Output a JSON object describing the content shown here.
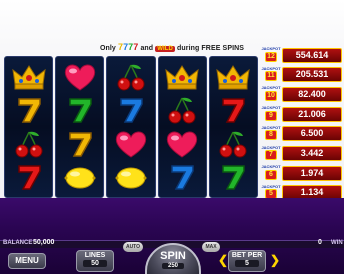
{
  "banner": {
    "only": "Only",
    "sevens": [
      "7",
      "7",
      "7",
      "7"
    ],
    "and": "and",
    "wild": "WILD",
    "during": "during FREE SPINS"
  },
  "reels": [
    [
      "crown",
      "seven-gold",
      "cherry",
      "seven-red"
    ],
    [
      "heart",
      "seven-green",
      "seven-gold",
      "lemon"
    ],
    [
      "cherry",
      "seven-blue",
      "heart",
      "lemon"
    ],
    [
      "crown",
      "cherry",
      "heart",
      "seven-blue"
    ],
    [
      "crown",
      "seven-red",
      "cherry",
      "seven-green"
    ]
  ],
  "jackpots": [
    {
      "label": "JACKPOT",
      "level": "12",
      "value": "554.614"
    },
    {
      "label": "JACKPOT",
      "level": "11",
      "value": "205.531"
    },
    {
      "label": "JACKPOT",
      "level": "10",
      "value": "82.400"
    },
    {
      "label": "JACKPOT",
      "level": "9",
      "value": "21.006"
    },
    {
      "label": "JACKPOT",
      "level": "8",
      "value": "6.500"
    },
    {
      "label": "JACKPOT",
      "level": "7",
      "value": "3.442"
    },
    {
      "label": "JACKPOT",
      "level": "6",
      "value": "1.974"
    },
    {
      "label": "JACKPOT",
      "level": "5",
      "value": "1.134"
    }
  ],
  "status": {
    "balance_label": "BALANCE",
    "balance_value": "50,000",
    "win_value": "0",
    "win_label": "WIN"
  },
  "controls": {
    "menu": "MENU",
    "lines_label": "LINES",
    "lines_value": "50",
    "auto": "AUTO",
    "max": "MAX",
    "spin": "SPIN",
    "spin_total": "250",
    "bet_label": "BET PER",
    "bet_value": "5"
  },
  "colors": {
    "bar": "#2a0552",
    "jackpot_bg": "#b01010",
    "gold": "#ffd400"
  }
}
